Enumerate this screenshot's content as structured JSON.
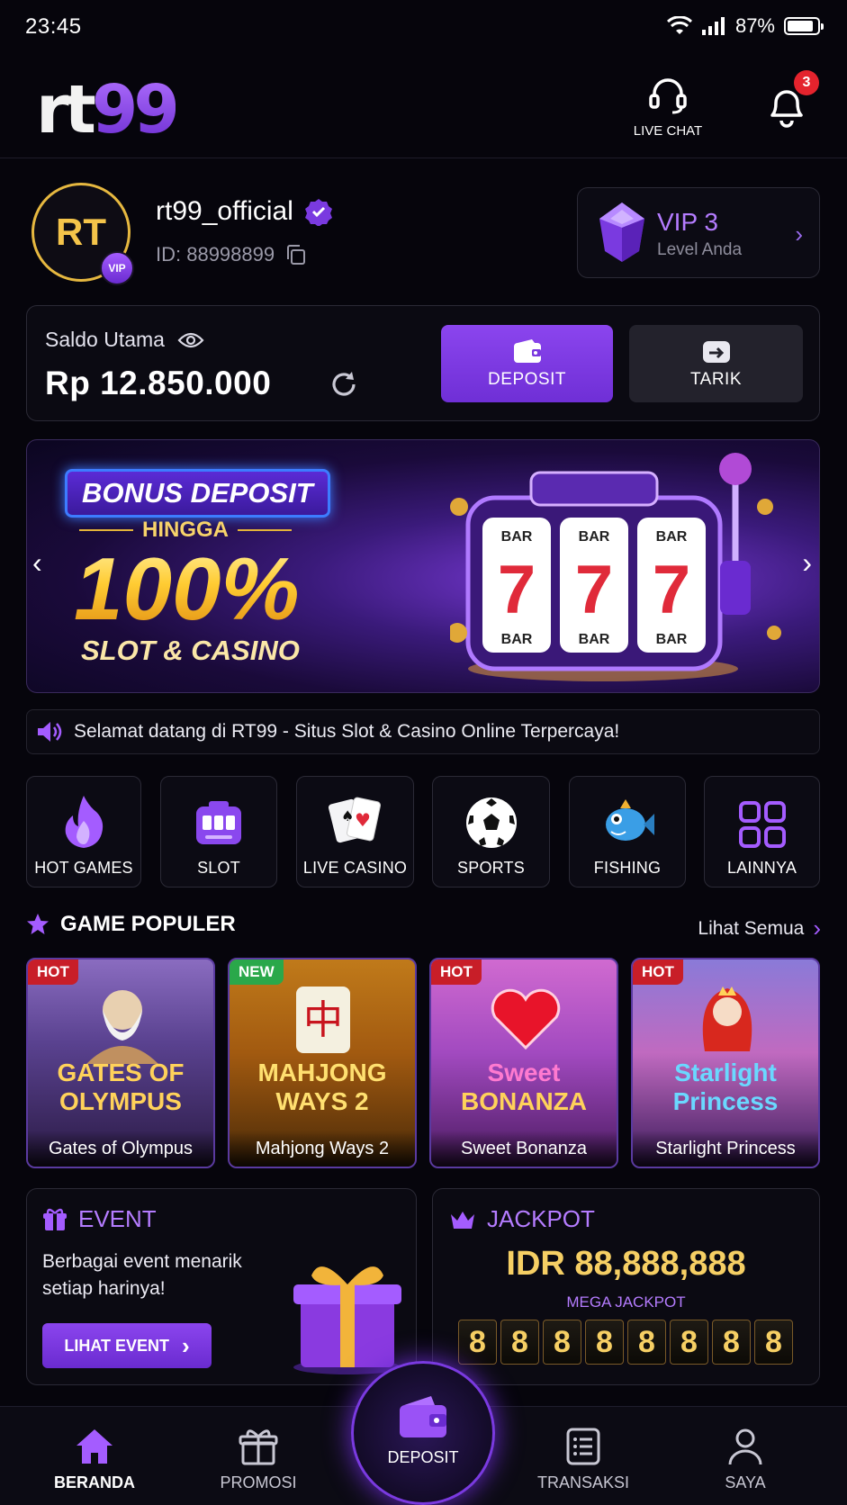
{
  "status_bar": {
    "time": "23:45",
    "battery": "87%",
    "battery_level": 0.87
  },
  "header": {
    "logo_rt": "rt",
    "logo_99": "99",
    "live_chat_label": "LIVE CHAT",
    "notification_count": "3"
  },
  "profile": {
    "avatar_initials": "RT",
    "vip_badge": "VIP",
    "username": "rt99_official",
    "user_id": "ID: 88998899",
    "vip_level": "VIP 3",
    "vip_sub": "Level Anda"
  },
  "balance": {
    "label": "Saldo Utama",
    "amount": "Rp 12.850.000",
    "deposit_label": "DEPOSIT",
    "withdraw_label": "TARIK"
  },
  "banner": {
    "tag": "BONUS DEPOSIT",
    "upto": "HINGGA",
    "percent": "100%",
    "subtitle": "SLOT & CASINO",
    "reel_top": "BAR",
    "reel_symbol": "7",
    "reel_bottom": "BAR"
  },
  "marquee": {
    "text": "Selamat datang di RT99 - Situs Slot & Casino Online Terpercaya!"
  },
  "categories": [
    {
      "label": "HOT GAMES",
      "icon": "fire-icon"
    },
    {
      "label": "SLOT",
      "icon": "slot-machine-icon"
    },
    {
      "label": "LIVE CASINO",
      "icon": "playing-cards-icon"
    },
    {
      "label": "SPORTS",
      "icon": "soccer-ball-icon"
    },
    {
      "label": "FISHING",
      "icon": "fish-icon"
    },
    {
      "label": "LAINNYA",
      "icon": "grid-icon"
    }
  ],
  "popular": {
    "title": "GAME POPULER",
    "see_all": "Lihat Semua",
    "games": [
      {
        "badge": "HOT",
        "logo_line1": "GATES OF",
        "logo_line2": "OLYMPUS",
        "name": "Gates of Olympus"
      },
      {
        "badge": "NEW",
        "logo_line1": "MAHJONG",
        "logo_line2": "WAYS 2",
        "name": "Mahjong Ways 2"
      },
      {
        "badge": "HOT",
        "logo_line1": "Sweet",
        "logo_line2": "BONANZA",
        "name": "Sweet Bonanza"
      },
      {
        "badge": "HOT",
        "logo_line1": "Starlight",
        "logo_line2": "Princess",
        "name": "Starlight Princess"
      }
    ]
  },
  "event": {
    "title": "EVENT",
    "text": "Berbagai event menarik setiap harinya!",
    "button": "LIHAT EVENT"
  },
  "jackpot": {
    "title": "JACKPOT",
    "amount": "IDR 88,888,888",
    "label": "MEGA JACKPOT",
    "digits": [
      "8",
      "8",
      "8",
      "8",
      "8",
      "8",
      "8",
      "8"
    ]
  },
  "bottom_nav": {
    "home": "BERANDA",
    "promo": "PROMOSI",
    "deposit": "DEPOSIT",
    "transactions": "TRANSAKSI",
    "me": "SAYA"
  },
  "colors": {
    "accent": "#8b45ee",
    "gold": "#f6cf64",
    "background": "#06050c"
  }
}
